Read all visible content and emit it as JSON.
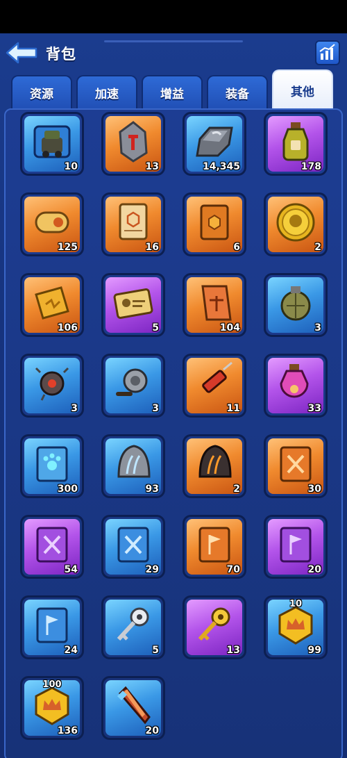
{
  "header": {
    "title": "背包"
  },
  "tabs": [
    {
      "label": "资源",
      "active": false
    },
    {
      "label": "加速",
      "active": false
    },
    {
      "label": "增益",
      "active": false
    },
    {
      "label": "装备",
      "active": false
    },
    {
      "label": "其他",
      "active": true
    }
  ],
  "items": [
    {
      "icon": "armored-car-puzzle-icon",
      "rarity": "blue",
      "count": "10"
    },
    {
      "icon": "red-rune-stone-icon",
      "rarity": "orange",
      "count": "13"
    },
    {
      "icon": "iron-ingot-icon",
      "rarity": "blue",
      "count": "14,345"
    },
    {
      "icon": "potion-bottle-icon",
      "rarity": "purple",
      "count": "178"
    },
    {
      "icon": "scroll-icon",
      "rarity": "orange",
      "count": "125"
    },
    {
      "icon": "blueprint-parchment-icon",
      "rarity": "orange",
      "count": "16"
    },
    {
      "icon": "orange-book-icon",
      "rarity": "orange",
      "count": "6"
    },
    {
      "icon": "gold-coin-icon",
      "rarity": "orange",
      "count": "2"
    },
    {
      "icon": "speed-ticket-icon",
      "rarity": "orange",
      "count": "106"
    },
    {
      "icon": "id-card-icon",
      "rarity": "purple",
      "count": "5"
    },
    {
      "icon": "justice-ticket-icon",
      "rarity": "orange",
      "count": "104"
    },
    {
      "icon": "grenade-icon",
      "rarity": "blue",
      "count": "3"
    },
    {
      "icon": "robot-drone-icon",
      "rarity": "blue",
      "count": "3"
    },
    {
      "icon": "fishing-reel-icon",
      "rarity": "blue",
      "count": "3"
    },
    {
      "icon": "syringe-icon",
      "rarity": "orange",
      "count": "11"
    },
    {
      "icon": "pink-potion-icon",
      "rarity": "purple",
      "count": "33"
    },
    {
      "icon": "paw-book-icon",
      "rarity": "blue",
      "count": "300"
    },
    {
      "icon": "silver-claw-stone-icon",
      "rarity": "blue",
      "count": "93"
    },
    {
      "icon": "fire-claw-stone-icon",
      "rarity": "orange",
      "count": "2"
    },
    {
      "icon": "sword-book-orange-icon",
      "rarity": "orange",
      "count": "30"
    },
    {
      "icon": "sword-book-purple-icon",
      "rarity": "purple",
      "count": "54"
    },
    {
      "icon": "sword-book-blue-icon",
      "rarity": "blue",
      "count": "29"
    },
    {
      "icon": "flag-book-orange-icon",
      "rarity": "orange",
      "count": "70"
    },
    {
      "icon": "flag-book-purple-icon",
      "rarity": "purple",
      "count": "20"
    },
    {
      "icon": "flag-book-blue-icon",
      "rarity": "blue",
      "count": "24"
    },
    {
      "icon": "silver-key-icon",
      "rarity": "blue",
      "count": "5"
    },
    {
      "icon": "gold-key-icon",
      "rarity": "purple",
      "count": "13"
    },
    {
      "icon": "crown-token-icon",
      "rarity": "blue",
      "count": "99",
      "top": "10"
    },
    {
      "icon": "crown-token-icon",
      "rarity": "blue",
      "count": "136",
      "top": "100"
    },
    {
      "icon": "crystal-shard-icon",
      "rarity": "blue",
      "count": "20"
    }
  ],
  "colors": {
    "blue": "#3a98e6",
    "orange": "#f08a2e",
    "purple": "#b354ea",
    "background": "#16337e"
  }
}
